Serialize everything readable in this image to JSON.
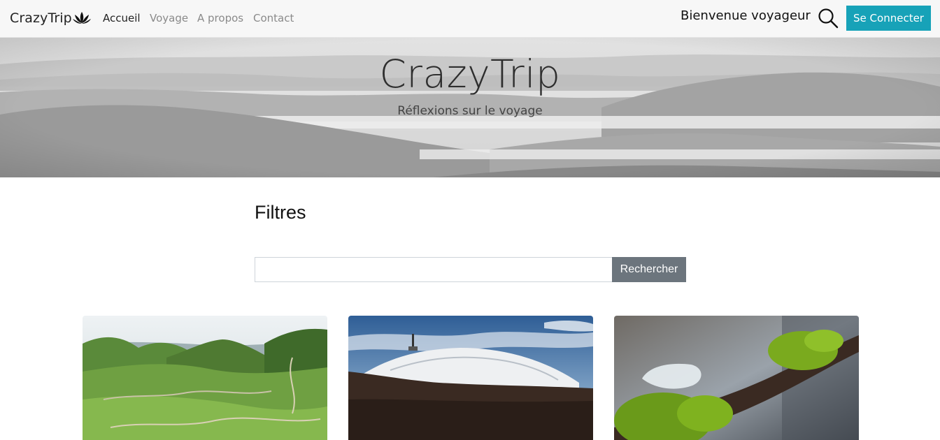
{
  "navbar": {
    "brand": "CrazyTrip",
    "brand_icon": "lotus-icon",
    "links": [
      "Accueil",
      "Voyage",
      "A propos",
      "Contact"
    ],
    "active_link": "Accueil",
    "welcome": "Bienvenue voyageur",
    "search_icon": "search-icon",
    "login_label": "Se Connecter"
  },
  "hero": {
    "title": "CrazyTrip",
    "subtitle": "Réflexions sur le voyage"
  },
  "filters": {
    "title": "Filtres",
    "search_placeholder": "",
    "search_value": "",
    "search_button": "Rechercher"
  },
  "colors": {
    "accent": "#17a2b8",
    "secondary": "#6c757d",
    "navbar_bg": "#f7f7f7"
  },
  "cards": [
    {
      "image": "green-mountain-valley"
    },
    {
      "image": "snowy-mountain-antenna"
    },
    {
      "image": "mossy-branch-ice"
    }
  ]
}
